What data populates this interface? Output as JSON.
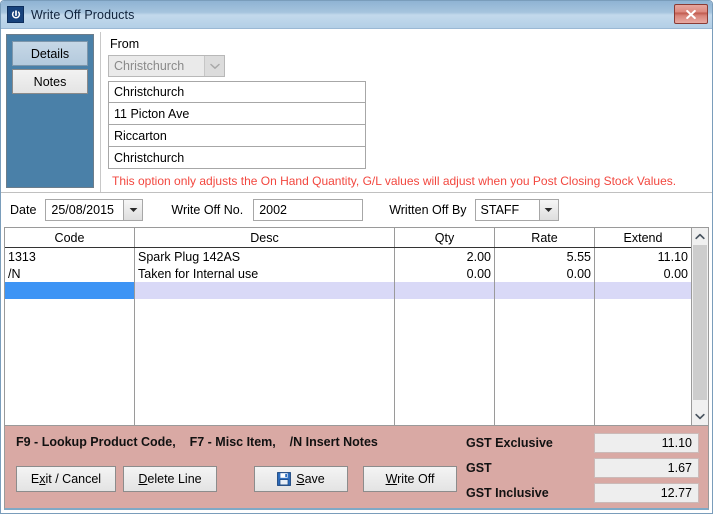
{
  "window": {
    "title": "Write Off Products",
    "app_icon": "power-icon",
    "close_label": "x"
  },
  "sidebar": {
    "tabs": [
      {
        "label": "Details",
        "selected": true
      },
      {
        "label": "Notes",
        "selected": false
      }
    ]
  },
  "from_panel": {
    "legend": "From",
    "branch_combo": {
      "value": "Christchurch",
      "disabled": true
    },
    "address_lines": [
      "Christchurch",
      "11 Picton Ave",
      "Riccarton",
      "Christchurch"
    ],
    "warning": "This option only adjusts the On Hand Quantity, G/L values will adjust when you Post Closing Stock Values."
  },
  "meta": {
    "date_label": "Date",
    "date_value": "25/08/2015",
    "writeoff_no_label": "Write Off No.",
    "writeoff_no_value": "2002",
    "written_off_by_label": "Written Off By",
    "written_off_by_value": "STAFF"
  },
  "grid": {
    "columns": [
      "Code",
      "Desc",
      "Qty",
      "Rate",
      "Extend"
    ],
    "rows": [
      {
        "code": "1313",
        "desc": "Spark Plug 142AS",
        "qty": "2.00",
        "rate": "5.55",
        "extend": "11.10",
        "selected": false
      },
      {
        "code": "/N",
        "desc": "Taken for Internal use",
        "qty": "0.00",
        "rate": "0.00",
        "extend": "0.00",
        "selected": false
      },
      {
        "code": "",
        "desc": "",
        "qty": "",
        "rate": "",
        "extend": "",
        "selected": true
      }
    ]
  },
  "footer": {
    "hint": "F9 - Lookup Product Code,    F7 - Misc Item,    /N Insert Notes",
    "buttons": {
      "exit": {
        "pre": "E",
        "accel": "x",
        "post": "it / Cancel"
      },
      "delete": {
        "pre": "",
        "accel": "D",
        "post": "elete Line"
      },
      "save": {
        "pre": "",
        "accel": "S",
        "post": "ave",
        "icon": "floppy-disk-icon"
      },
      "writeoff": {
        "pre": "",
        "accel": "W",
        "post": "rite Off"
      }
    },
    "totals": [
      {
        "label": "GST Exclusive",
        "value": "11.10"
      },
      {
        "label": "GST",
        "value": "1.67"
      },
      {
        "label": "GST Inclusive",
        "value": "12.77"
      }
    ]
  },
  "colors": {
    "sidebar": "#4a80a8",
    "footer_panel": "#d9a9a4",
    "warning_text": "#f2473f",
    "selection": "#3d94f5",
    "selection_row": "#d9d9f7"
  }
}
